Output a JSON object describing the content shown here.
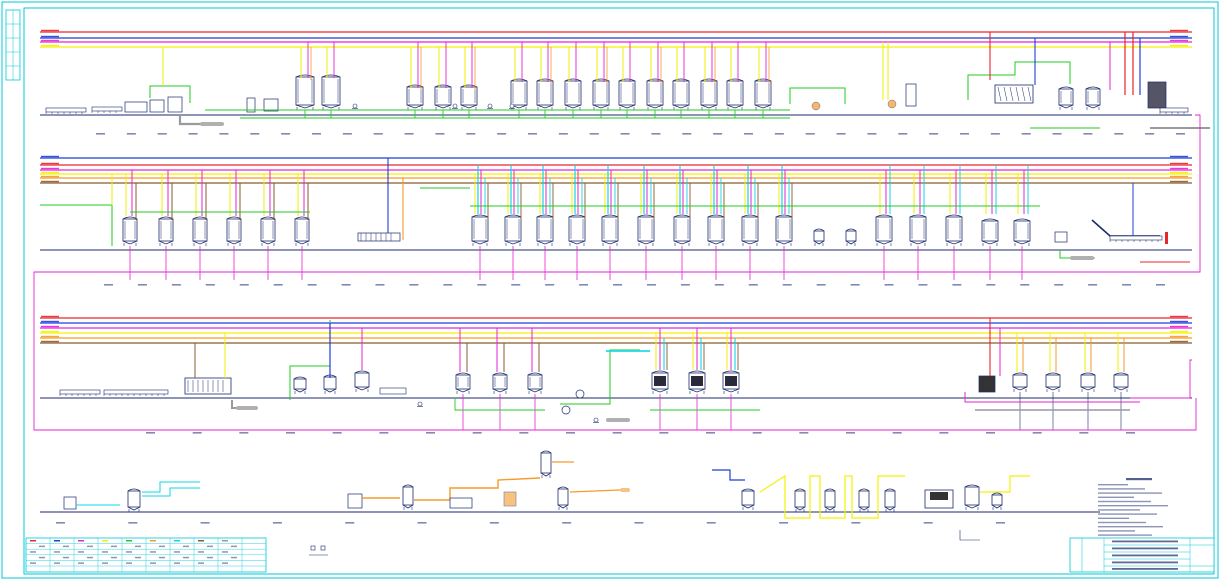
{
  "diagram": {
    "frame_color": "#00c8d8",
    "ink_color": "#1b2a6b",
    "pipe_colors": {
      "red": "#e8262b",
      "blue": "#1f3fd6",
      "magenta": "#e623d6",
      "yellow": "#f2f200",
      "orange": "#f59a2b",
      "green": "#22cc22",
      "cyan": "#12d6e8",
      "brown": "#8a5a2b",
      "grey": "#9a9a9a"
    },
    "icons": [
      "tank-icon",
      "pump-icon",
      "conveyor-icon",
      "heat-exchanger-icon",
      "vessel-icon"
    ]
  }
}
